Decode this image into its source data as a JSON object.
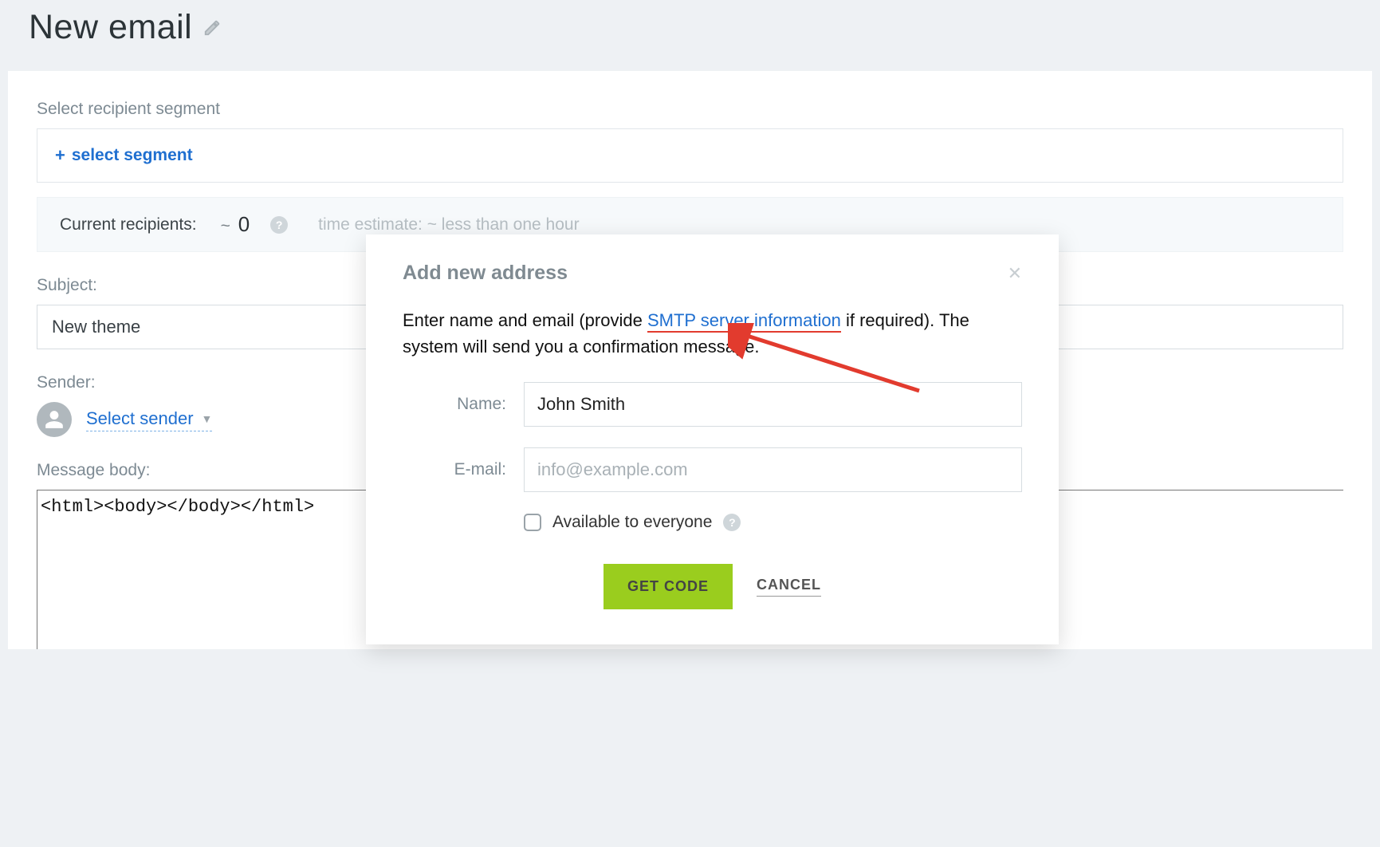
{
  "page": {
    "title": "New email"
  },
  "segment": {
    "label": "Select recipient segment",
    "select_label": "select segment"
  },
  "recipients": {
    "label": "Current recipients:",
    "approx": "~",
    "count": "0",
    "time_estimate": "time estimate: ~ less than one hour"
  },
  "subject": {
    "label": "Subject:",
    "value": "New theme"
  },
  "sender": {
    "label": "Sender:",
    "select_label": "Select sender"
  },
  "body": {
    "label": "Message body:",
    "value": "<html><body></body></html>"
  },
  "modal": {
    "title": "Add new address",
    "desc_before": "Enter name and email (provide ",
    "smtp_link": "SMTP server information",
    "desc_after": " if required). The system will send you a confirmation message.",
    "name_label": "Name:",
    "name_value": "John Smith",
    "email_label": "E-mail:",
    "email_placeholder": "info@example.com",
    "available_label": "Available to everyone",
    "getcode_label": "GET CODE",
    "cancel_label": "CANCEL"
  }
}
